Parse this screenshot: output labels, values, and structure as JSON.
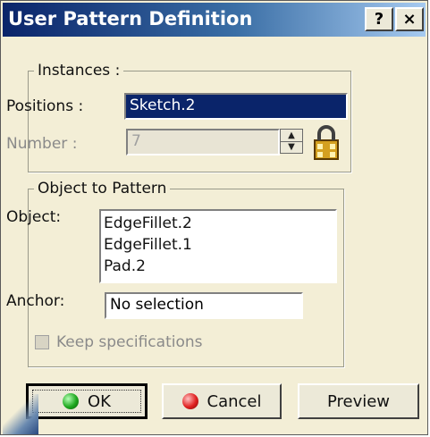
{
  "window": {
    "title": "User Pattern Definition",
    "help_button": "?",
    "close_button": "×"
  },
  "instances": {
    "legend": "Instances :",
    "positions_label": "Positions :",
    "positions_value": "Sketch.2",
    "number_label": "Number :",
    "number_value": "7"
  },
  "object_group": {
    "legend": "Object to Pattern",
    "object_label": "Object:",
    "object_items": [
      "EdgeFillet.2",
      "EdgeFillet.1",
      "Pad.2"
    ],
    "anchor_label": "Anchor:",
    "anchor_value": "No selection",
    "keep_specs_label": "Keep specifications"
  },
  "buttons": {
    "ok": "OK",
    "cancel": "Cancel",
    "preview": "Preview"
  },
  "colors": {
    "dialog_bg": "#f3eed6",
    "title_bar_start": "#0a246a",
    "title_bar_end": "#a6caf0",
    "selection_bg": "#0a246a"
  },
  "icons": {
    "ok": "green-ball-icon",
    "cancel": "red-ball-icon",
    "spinner": "up-down-spinner-icon",
    "lock": "lock-icon"
  }
}
